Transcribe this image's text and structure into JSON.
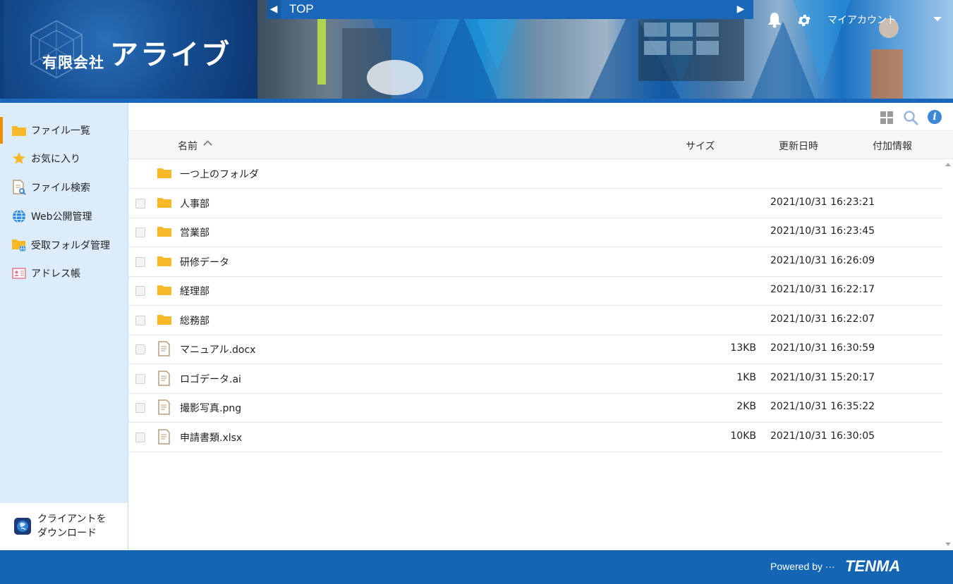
{
  "header": {
    "company_prefix": "有限会社",
    "company_name": "アライブ",
    "breadcrumb_current": "TOP",
    "account_label": "マイアカウント"
  },
  "sidebar": {
    "items": [
      {
        "label": "ファイル一覧",
        "icon": "folder-icon",
        "active": true
      },
      {
        "label": "お気に入り",
        "icon": "star-icon",
        "active": false
      },
      {
        "label": "ファイル検索",
        "icon": "file-search-icon",
        "active": false
      },
      {
        "label": "Web公開管理",
        "icon": "globe-icon",
        "active": false
      },
      {
        "label": "受取フォルダ管理",
        "icon": "receive-folder-icon",
        "active": false
      },
      {
        "label": "アドレス帳",
        "icon": "address-book-icon",
        "active": false
      }
    ],
    "download_line1": "クライアントを",
    "download_line2": "ダウンロード"
  },
  "columns": {
    "name": "名前",
    "size": "サイズ",
    "modified": "更新日時",
    "extra": "付加情報"
  },
  "parent_folder": "一つ上のフォルダ",
  "files": [
    {
      "name": "人事部",
      "type": "folder",
      "size": "",
      "date": "2021/10/31 16:23:21"
    },
    {
      "name": "営業部",
      "type": "folder",
      "size": "",
      "date": "2021/10/31 16:23:45"
    },
    {
      "name": "研修データ",
      "type": "folder",
      "size": "",
      "date": "2021/10/31 16:26:09"
    },
    {
      "name": "経理部",
      "type": "folder",
      "size": "",
      "date": "2021/10/31 16:22:17"
    },
    {
      "name": "総務部",
      "type": "folder",
      "size": "",
      "date": "2021/10/31 16:22:07"
    },
    {
      "name": "マニュアル.docx",
      "type": "file",
      "size": "13KB",
      "date": "2021/10/31 16:30:59"
    },
    {
      "name": "ロゴデータ.ai",
      "type": "file",
      "size": "1KB",
      "date": "2021/10/31 15:20:17"
    },
    {
      "name": "撮影写真.png",
      "type": "file",
      "size": "2KB",
      "date": "2021/10/31 16:35:22"
    },
    {
      "name": "申請書類.xlsx",
      "type": "file",
      "size": "10KB",
      "date": "2021/10/31 16:30:05"
    }
  ],
  "footer": {
    "powered_by": "Powered by ···",
    "brand": "TENMA"
  },
  "colors": {
    "header_blue": "#0c3f80",
    "footer_blue": "#1565b5",
    "sidebar_bg": "#ddecfb",
    "active_accent": "#f08a00",
    "folder_yellow": "#f7b928"
  }
}
